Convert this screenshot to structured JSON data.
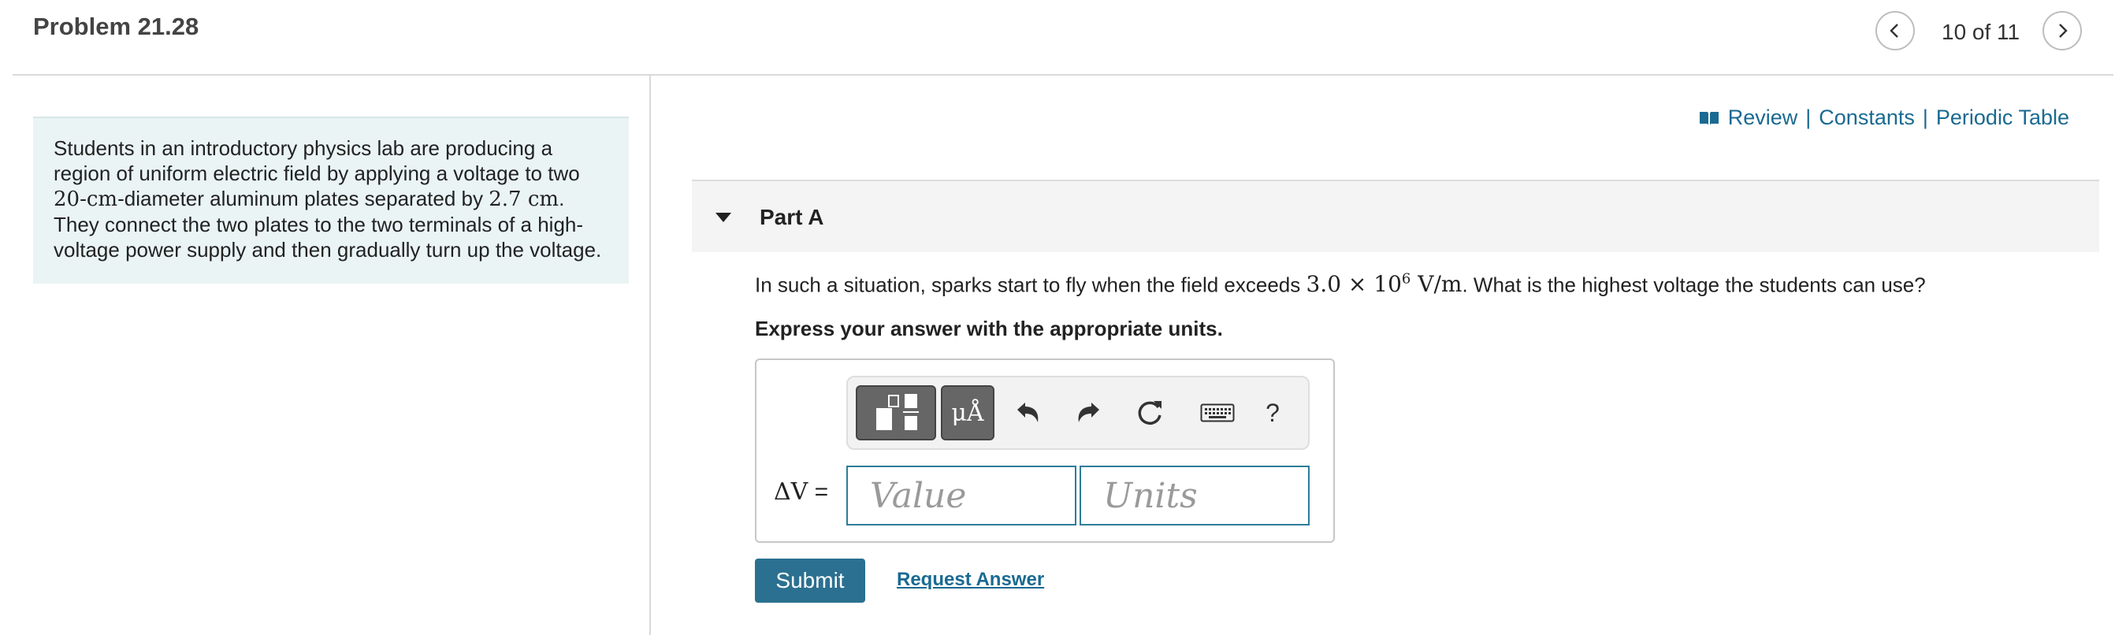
{
  "header": {
    "title": "Problem 21.28",
    "counter": "10 of 11"
  },
  "intro": {
    "text_before": "Students in an introductory physics lab are producing a region of uniform electric field by applying a voltage to two ",
    "diameter": "20-cm",
    "text_mid": "-diameter aluminum plates separated by ",
    "separation": "2.7 cm",
    "text_after": ". They connect the two plates to the two terminals of a high-voltage power supply and then gradually turn up the voltage."
  },
  "resources": {
    "review": "Review",
    "constants": "Constants",
    "periodic_table": "Periodic Table",
    "separator": "|"
  },
  "part": {
    "label": "Part A",
    "question_before": "In such a situation, sparks start to fly when the field exceeds ",
    "field_value": "3.0 × 10",
    "field_exponent": "6",
    "field_units": " V/m",
    "question_after": ". What is the highest voltage the students can use?",
    "instruction": "Express your answer with the appropriate units."
  },
  "answer": {
    "variable": "ΔV",
    "equals": " =",
    "value_placeholder": "Value",
    "units_placeholder": "Units",
    "units_button": "μÅ",
    "help_button": "?"
  },
  "actions": {
    "submit": "Submit",
    "request_answer": "Request Answer"
  },
  "colors": {
    "accent": "#2b7090",
    "link": "#1a6a91",
    "intro_bg": "#eaf4f5",
    "input_border": "#2d7d98"
  },
  "icons": [
    "chevron-left-icon",
    "chevron-right-icon",
    "book-icon",
    "caret-down-icon",
    "template-icon",
    "undo-icon",
    "redo-icon",
    "reset-icon",
    "keyboard-icon"
  ]
}
